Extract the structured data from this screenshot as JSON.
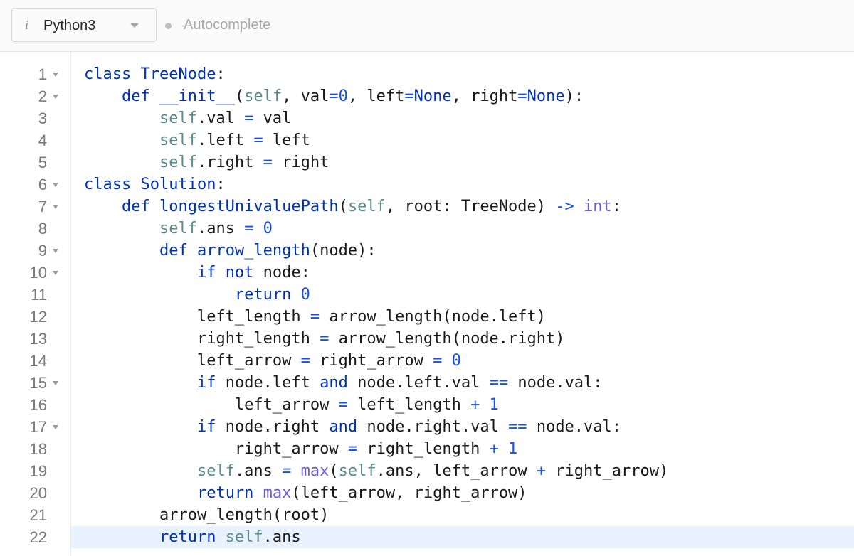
{
  "toolbar": {
    "info_glyph": "i",
    "language": "Python3",
    "autocomplete_label": "Autocomplete"
  },
  "editor": {
    "active_line": 22,
    "lines": [
      {
        "n": "1",
        "fold": true,
        "indent": 0,
        "tokens": [
          [
            "kw",
            "class "
          ],
          [
            "fn",
            "TreeNode"
          ],
          [
            "",
            ""
          ],
          [
            "",
            ":"
          ]
        ]
      },
      {
        "n": "2",
        "fold": true,
        "indent": 1,
        "tokens": [
          [
            "kw",
            "def "
          ],
          [
            "fn",
            "__init__"
          ],
          [
            "",
            "("
          ],
          [
            "self",
            "self"
          ],
          [
            "",
            ", val"
          ],
          [
            "op",
            "="
          ],
          [
            "num",
            "0"
          ],
          [
            "",
            ", left"
          ],
          [
            "op",
            "="
          ],
          [
            "kw",
            "None"
          ],
          [
            "",
            ", right"
          ],
          [
            "op",
            "="
          ],
          [
            "kw",
            "None"
          ],
          [
            "",
            "):"
          ]
        ]
      },
      {
        "n": "3",
        "fold": false,
        "indent": 2,
        "tokens": [
          [
            "self",
            "self"
          ],
          [
            "",
            ".val "
          ],
          [
            "op",
            "="
          ],
          [
            "",
            ""
          ],
          [
            "",
            " val"
          ]
        ]
      },
      {
        "n": "4",
        "fold": false,
        "indent": 2,
        "tokens": [
          [
            "self",
            "self"
          ],
          [
            "",
            ".left "
          ],
          [
            "op",
            "="
          ],
          [
            "",
            " left"
          ]
        ]
      },
      {
        "n": "5",
        "fold": false,
        "indent": 2,
        "tokens": [
          [
            "self",
            "self"
          ],
          [
            "",
            ".right "
          ],
          [
            "op",
            "="
          ],
          [
            "",
            " right"
          ]
        ]
      },
      {
        "n": "6",
        "fold": true,
        "indent": 0,
        "tokens": [
          [
            "kw",
            "class "
          ],
          [
            "fn",
            "Solution"
          ],
          [
            "",
            ":"
          ]
        ]
      },
      {
        "n": "7",
        "fold": true,
        "indent": 1,
        "tokens": [
          [
            "kw",
            "def "
          ],
          [
            "fn",
            "longestUnivaluePath"
          ],
          [
            "",
            "("
          ],
          [
            "self",
            "self"
          ],
          [
            "",
            ", root: TreeNode) "
          ],
          [
            "op",
            "->"
          ],
          [
            "",
            ""
          ],
          [
            "bi",
            " int"
          ],
          [
            "",
            ":"
          ]
        ]
      },
      {
        "n": "8",
        "fold": false,
        "indent": 2,
        "tokens": [
          [
            "self",
            "self"
          ],
          [
            "",
            ".ans "
          ],
          [
            "op",
            "="
          ],
          [
            "num",
            " 0"
          ]
        ]
      },
      {
        "n": "9",
        "fold": true,
        "indent": 2,
        "tokens": [
          [
            "kw",
            "def "
          ],
          [
            "fn",
            "arrow_length"
          ],
          [
            "",
            "(node):"
          ]
        ]
      },
      {
        "n": "10",
        "fold": true,
        "indent": 3,
        "tokens": [
          [
            "kw",
            "if not"
          ],
          [
            "",
            " node:"
          ]
        ]
      },
      {
        "n": "11",
        "fold": false,
        "indent": 4,
        "tokens": [
          [
            "kw",
            "return "
          ],
          [
            "num",
            "0"
          ]
        ]
      },
      {
        "n": "12",
        "fold": false,
        "indent": 3,
        "tokens": [
          [
            "",
            "left_length "
          ],
          [
            "op",
            "="
          ],
          [
            "",
            " arrow_length(node.left)"
          ]
        ]
      },
      {
        "n": "13",
        "fold": false,
        "indent": 3,
        "tokens": [
          [
            "",
            "right_length "
          ],
          [
            "op",
            "="
          ],
          [
            "",
            " arrow_length(node.right)"
          ]
        ]
      },
      {
        "n": "14",
        "fold": false,
        "indent": 3,
        "tokens": [
          [
            "",
            "left_arrow "
          ],
          [
            "op",
            "="
          ],
          [
            "",
            " right_arrow "
          ],
          [
            "op",
            "="
          ],
          [
            "num",
            " 0"
          ]
        ]
      },
      {
        "n": "15",
        "fold": true,
        "indent": 3,
        "tokens": [
          [
            "kw",
            "if"
          ],
          [
            "",
            " node.left "
          ],
          [
            "kw",
            "and"
          ],
          [
            "",
            " node.left.val "
          ],
          [
            "op",
            "=="
          ],
          [
            "",
            " node.val:"
          ]
        ]
      },
      {
        "n": "16",
        "fold": false,
        "indent": 4,
        "tokens": [
          [
            "",
            "left_arrow "
          ],
          [
            "op",
            "="
          ],
          [
            "",
            " left_length "
          ],
          [
            "op",
            "+"
          ],
          [
            "num",
            " 1"
          ]
        ]
      },
      {
        "n": "17",
        "fold": true,
        "indent": 3,
        "tokens": [
          [
            "kw",
            "if"
          ],
          [
            "",
            " node.right "
          ],
          [
            "kw",
            "and"
          ],
          [
            "",
            " node.right.val "
          ],
          [
            "op",
            "=="
          ],
          [
            "",
            " node.val:"
          ]
        ]
      },
      {
        "n": "18",
        "fold": false,
        "indent": 4,
        "tokens": [
          [
            "",
            "right_arrow "
          ],
          [
            "op",
            "="
          ],
          [
            "",
            " right_length "
          ],
          [
            "op",
            "+"
          ],
          [
            "num",
            " 1"
          ]
        ]
      },
      {
        "n": "19",
        "fold": false,
        "indent": 3,
        "tokens": [
          [
            "self",
            "self"
          ],
          [
            "",
            ".ans "
          ],
          [
            "op",
            "="
          ],
          [
            "bi",
            " max"
          ],
          [
            "",
            "("
          ],
          [
            "self",
            "self"
          ],
          [
            "",
            ".ans, left_arrow "
          ],
          [
            "op",
            "+"
          ],
          [
            "",
            " right_arrow)"
          ]
        ]
      },
      {
        "n": "20",
        "fold": false,
        "indent": 3,
        "tokens": [
          [
            "kw",
            "return "
          ],
          [
            "bi",
            "max"
          ],
          [
            "",
            "(left_arrow, right_arrow)"
          ]
        ]
      },
      {
        "n": "21",
        "fold": false,
        "indent": 2,
        "tokens": [
          [
            "",
            "arrow_length(root)"
          ]
        ]
      },
      {
        "n": "22",
        "fold": false,
        "indent": 2,
        "tokens": [
          [
            "kw",
            "return "
          ],
          [
            "self",
            "self"
          ],
          [
            "",
            ".ans"
          ]
        ]
      }
    ]
  }
}
